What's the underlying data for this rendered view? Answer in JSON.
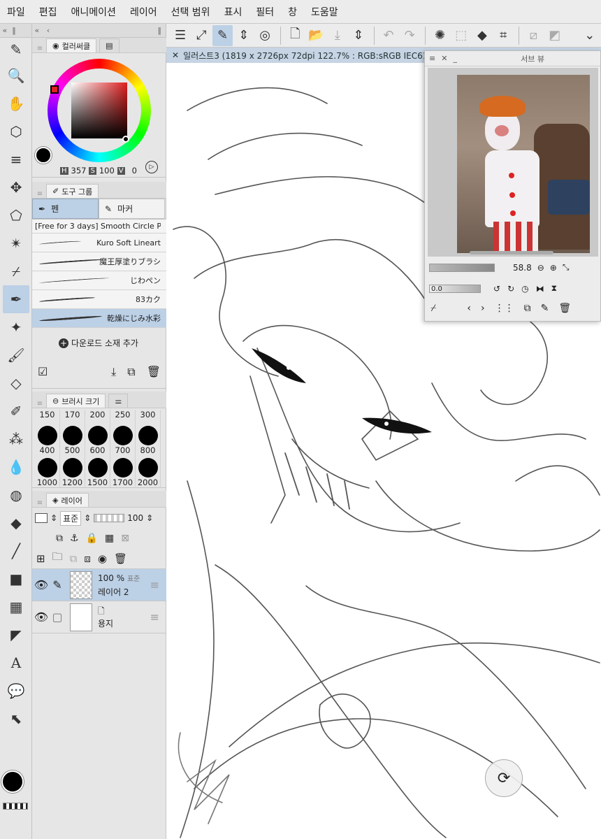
{
  "menu": [
    "파일",
    "편집",
    "애니메이션",
    "레이어",
    "선택 범위",
    "표시",
    "필터",
    "창",
    "도움말"
  ],
  "toolbar_icons": [
    "menu-icon",
    "resize-icon",
    "pen-edit-icon",
    "chevron-updown-icon",
    "spiral-icon",
    "new-file-icon",
    "open-folder-icon",
    "save-icon",
    "chevron-updown-icon",
    "undo-icon",
    "redo-icon",
    "loading-icon",
    "select-icon",
    "fill-icon",
    "transform-icon",
    "deselect-icon",
    "grid-icon",
    "chevron-down-icon"
  ],
  "color_panel": {
    "tab_label": "컬러써클",
    "h_label": "H",
    "h_value": "357",
    "s_label": "S",
    "s_value": "100",
    "v_label": "V",
    "v_value": "0",
    "current_color": "#000000"
  },
  "tool_group": {
    "tab_label": "도구 그룹",
    "tabs": [
      "펜",
      "마커"
    ],
    "brushes": [
      "[Free for 3 days] Smooth Circle P",
      "Kuro Soft Lineart",
      "魔王厚塗りブラシ",
      "じわペン",
      "83カク",
      "乾燥にじみ水彩"
    ],
    "add_material": "다운로드 소재 추가"
  },
  "brush_size": {
    "tab_label": "브러시 크기",
    "sizes": [
      "150",
      "170",
      "200",
      "250",
      "300",
      "400",
      "500",
      "600",
      "700",
      "800",
      "1000",
      "1200",
      "1500",
      "1700",
      "2000"
    ]
  },
  "layers": {
    "tab_label": "레이어",
    "blend_mode": "표준",
    "opacity": "100",
    "items": [
      {
        "percent": "100 %",
        "mode": "표준",
        "name": "레이어 2"
      },
      {
        "name": "용지"
      }
    ]
  },
  "document": {
    "tab_title": "일러스트3 (1819 x 2726px 72dpi 122.7% : RGB:sRGB IEC61966-"
  },
  "sub_view": {
    "title": "서브 뷰",
    "zoom": "58.8",
    "angle": "0.0"
  }
}
